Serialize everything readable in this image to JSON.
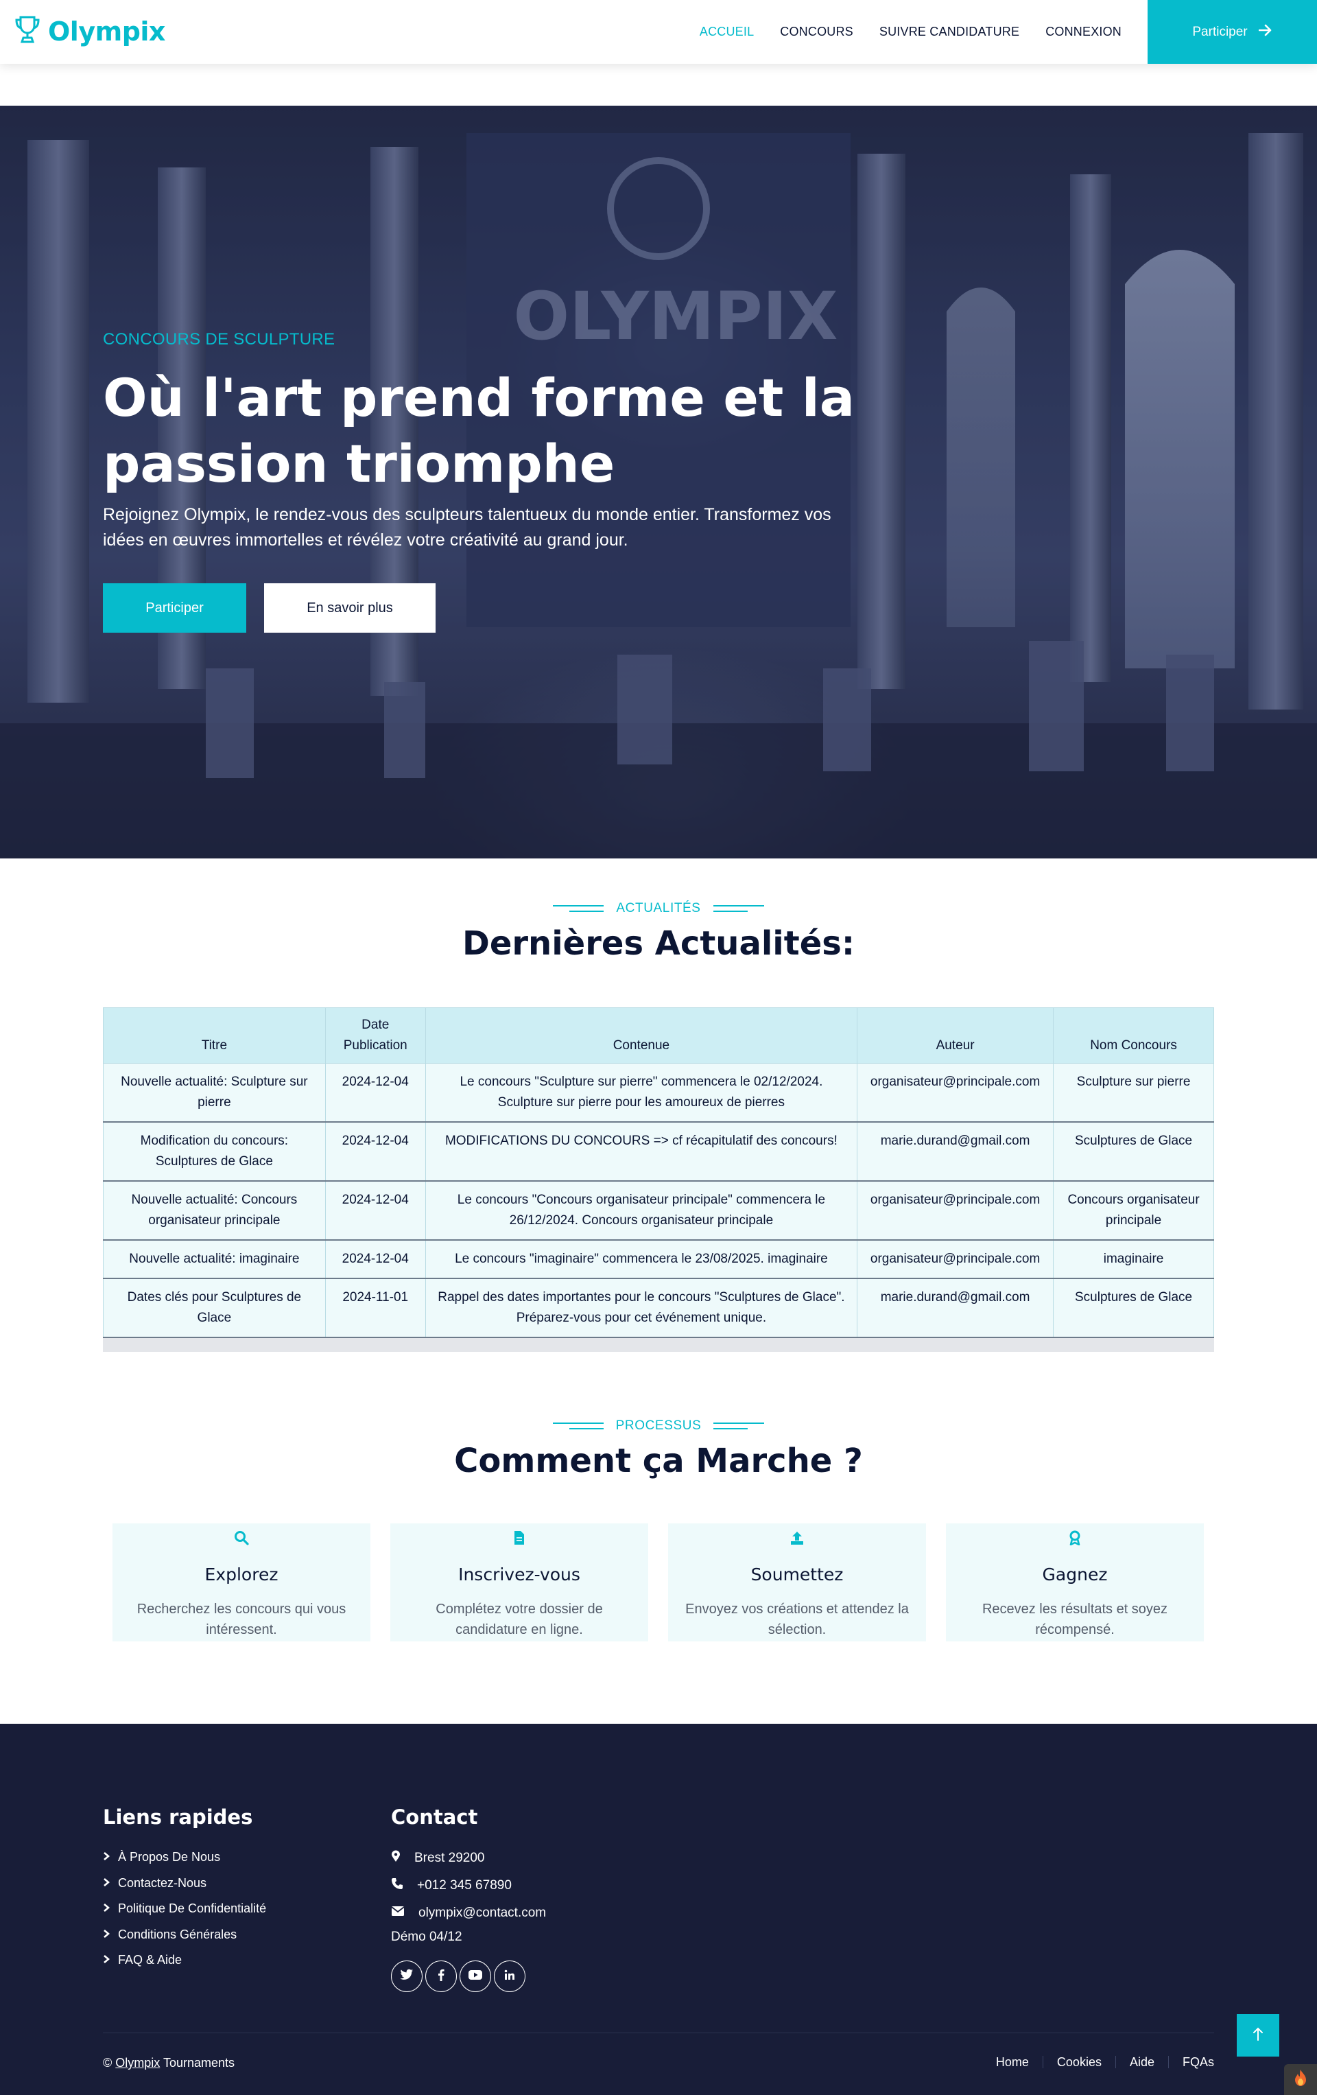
{
  "nav": {
    "brand": "Olympix",
    "links": [
      {
        "label": "ACCUEIL",
        "active": true
      },
      {
        "label": "CONCOURS",
        "active": false
      },
      {
        "label": "SUIVRE CANDIDATURE",
        "active": false
      },
      {
        "label": "CONNEXION",
        "active": false
      }
    ],
    "cta_label": "Participer"
  },
  "hero": {
    "eyebrow": "CONCOURS DE SCULPTURE",
    "title": "Où l'art prend forme et la passion triomphe",
    "description": "Rejoignez Olympix, le rendez-vous des sculpteurs talentueux du monde entier. Transformez vos idées en œuvres immortelles et révélez votre créativité au grand jour.",
    "primary_button": "Participer",
    "secondary_button": "En savoir plus"
  },
  "news": {
    "eyebrow": "ACTUALITÉS",
    "title": "Dernières Actualités:",
    "columns": [
      "Titre",
      "Date Publication",
      "Contenue",
      "Auteur",
      "Nom Concours"
    ],
    "rows": [
      [
        "Nouvelle actualité: Sculpture sur pierre",
        "2024-12-04",
        "Le concours \"Sculpture sur pierre\" commencera le 02/12/2024. Sculpture sur pierre pour les amoureux de pierres",
        "organisateur@principale.com",
        "Sculpture sur pierre"
      ],
      [
        "Modification du concours: Sculptures de Glace",
        "2024-12-04",
        "MODIFICATIONS DU CONCOURS => cf récapitulatif des concours!",
        "marie.durand@gmail.com",
        "Sculptures de Glace"
      ],
      [
        "Nouvelle actualité: Concours organisateur principale",
        "2024-12-04",
        "Le concours \"Concours organisateur principale\" commencera le 26/12/2024. Concours organisateur principale",
        "organisateur@principale.com",
        "Concours organisateur principale"
      ],
      [
        "Nouvelle actualité: imaginaire",
        "2024-12-04",
        "Le concours \"imaginaire\" commencera le 23/08/2025. imaginaire",
        "organisateur@principale.com",
        "imaginaire"
      ],
      [
        "Dates clés pour Sculptures de Glace",
        "2024-11-01",
        "Rappel des dates importantes pour le concours \"Sculptures de Glace\". Préparez-vous pour cet événement unique.",
        "marie.durand@gmail.com",
        "Sculptures de Glace"
      ]
    ]
  },
  "process": {
    "eyebrow": "PROCESSUS",
    "title": "Comment ça Marche ?",
    "steps": [
      {
        "icon": "search-icon",
        "title": "Explorez",
        "text": "Recherchez les concours qui vous intéressent."
      },
      {
        "icon": "file-icon",
        "title": "Inscrivez-vous",
        "text": "Complétez votre dossier de candidature en ligne."
      },
      {
        "icon": "upload-icon",
        "title": "Soumettez",
        "text": "Envoyez vos créations et attendez la sélection."
      },
      {
        "icon": "award-icon",
        "title": "Gagnez",
        "text": "Recevez les résultats et soyez récompensé."
      }
    ]
  },
  "footer": {
    "quick_links_title": "Liens rapides",
    "quick_links": [
      "À Propos De Nous",
      "Contactez-Nous",
      "Politique De Confidentialité",
      "Conditions Générales",
      "FAQ & Aide"
    ],
    "contact_title": "Contact",
    "address": "Brest 29200",
    "phone": "+012 345 67890",
    "email": "olympix@contact.com",
    "demo": "Démo 04/12",
    "socials": [
      "twitter-icon",
      "facebook-icon",
      "youtube-icon",
      "linkedin-icon"
    ],
    "copyright_prefix": "©",
    "copyright_brand": "Olympix",
    "copyright_suffix": "Tournaments",
    "bottom_links": [
      "Home",
      "Cookies",
      "Aide",
      "FQAs"
    ]
  },
  "colors": {
    "accent": "#06bbcc",
    "dark": "#181d38",
    "text": "#0b1533"
  }
}
